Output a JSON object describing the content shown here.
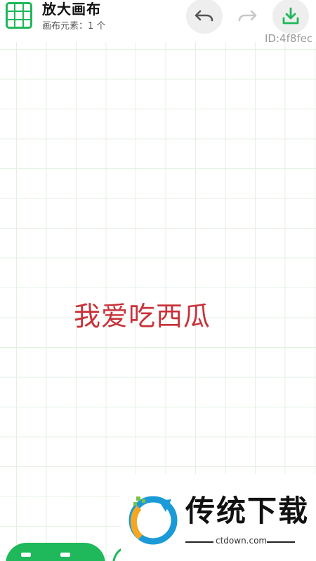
{
  "header": {
    "title": "放大画布",
    "subtitle": "画布元素：1 个",
    "id_label": "ID:4f8fec",
    "icons": {
      "app": "grid-icon",
      "undo": "undo-icon",
      "redo": "redo-icon",
      "download": "download-icon"
    }
  },
  "canvas": {
    "text_element": "我爱吃西瓜"
  },
  "watermark": {
    "brand": "传统下载",
    "domain": "ctdown.com"
  },
  "colors": {
    "accent": "#1fb85a",
    "canvas_text": "#c8323a",
    "grid_line": "#e3f1e3"
  }
}
